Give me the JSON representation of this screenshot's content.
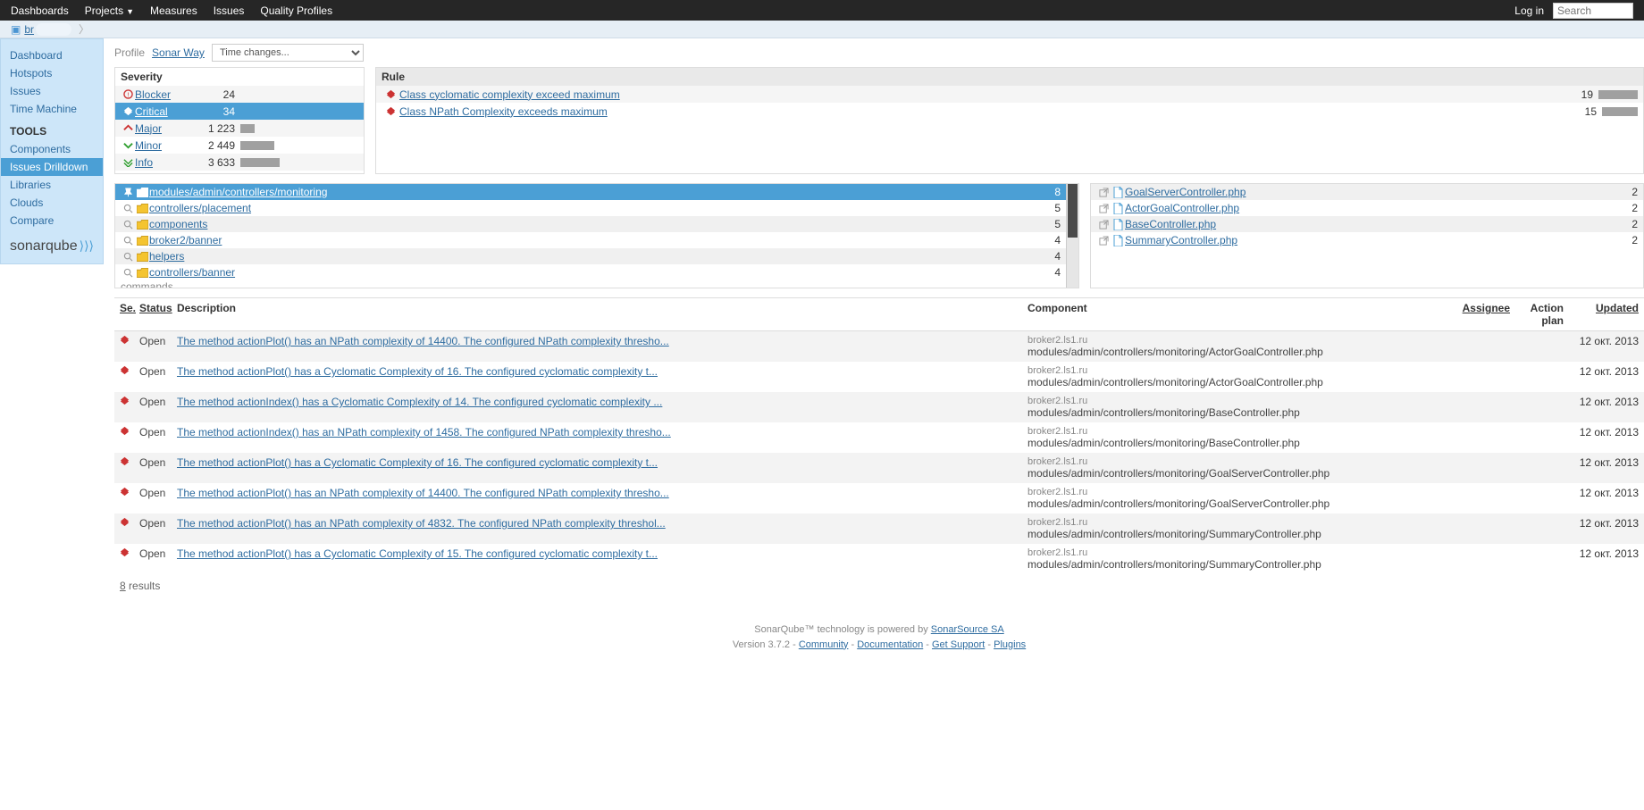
{
  "topnav": {
    "items": [
      "Dashboards",
      "Projects",
      "Measures",
      "Issues",
      "Quality Profiles"
    ],
    "login": "Log in",
    "search_placeholder": "Search"
  },
  "breadcrumb": {
    "project": "br"
  },
  "sidebar": {
    "items": [
      "Dashboard",
      "Hotspots",
      "Issues",
      "Time Machine"
    ],
    "tools_header": "TOOLS",
    "tools": [
      "Components",
      "Issues Drilldown",
      "Libraries",
      "Clouds",
      "Compare"
    ],
    "logo": "sonarqube"
  },
  "profile": {
    "label": "Profile",
    "name": "Sonar Way",
    "time_changes": "Time changes..."
  },
  "severity": {
    "header": "Severity",
    "rows": [
      {
        "name": "Blocker",
        "count": "24",
        "bar": 0
      },
      {
        "name": "Critical",
        "count": "34",
        "bar": 0,
        "selected": true
      },
      {
        "name": "Major",
        "count": "1 223",
        "bar": 16
      },
      {
        "name": "Minor",
        "count": "2 449",
        "bar": 38
      },
      {
        "name": "Info",
        "count": "3 633",
        "bar": 44
      }
    ]
  },
  "rule": {
    "header": "Rule",
    "rows": [
      {
        "name": "Class cyclomatic complexity exceed maximum",
        "count": "19",
        "bar": 44
      },
      {
        "name": "Class NPath Complexity exceeds maximum",
        "count": "15",
        "bar": 40
      }
    ]
  },
  "folders": {
    "rows": [
      {
        "name": "modules/admin/controllers/monitoring",
        "count": "8",
        "selected": true
      },
      {
        "name": "controllers/placement",
        "count": "5"
      },
      {
        "name": "components",
        "count": "5"
      },
      {
        "name": "broker2/banner",
        "count": "4"
      },
      {
        "name": "helpers",
        "count": "4"
      },
      {
        "name": "controllers/banner",
        "count": "4"
      }
    ],
    "truncated": "commands"
  },
  "files": {
    "rows": [
      {
        "name": "GoalServerController.php",
        "count": "2"
      },
      {
        "name": "ActorGoalController.php",
        "count": "2"
      },
      {
        "name": "BaseController.php",
        "count": "2"
      },
      {
        "name": "SummaryController.php",
        "count": "2"
      }
    ]
  },
  "issues": {
    "headers": {
      "se": "Se.",
      "status": "Status",
      "desc": "Description",
      "comp": "Component",
      "assignee": "Assignee",
      "plan": "Action plan",
      "updated": "Updated"
    },
    "rows": [
      {
        "status": "Open",
        "desc": "The method actionPlot() has an NPath complexity of 14400. The configured NPath complexity thresho...",
        "proj": "broker2.ls1.ru",
        "path": "modules/admin/controllers/monitoring/ActorGoalController.php",
        "updated": "12 окт. 2013"
      },
      {
        "status": "Open",
        "desc": "The method actionPlot() has a Cyclomatic Complexity of 16. The configured cyclomatic complexity t...",
        "proj": "broker2.ls1.ru",
        "path": "modules/admin/controllers/monitoring/ActorGoalController.php",
        "updated": "12 окт. 2013"
      },
      {
        "status": "Open",
        "desc": "The method actionIndex() has a Cyclomatic Complexity of 14. The configured cyclomatic complexity ...",
        "proj": "broker2.ls1.ru",
        "path": "modules/admin/controllers/monitoring/BaseController.php",
        "updated": "12 окт. 2013"
      },
      {
        "status": "Open",
        "desc": "The method actionIndex() has an NPath complexity of 1458. The configured NPath complexity thresho...",
        "proj": "broker2.ls1.ru",
        "path": "modules/admin/controllers/monitoring/BaseController.php",
        "updated": "12 окт. 2013"
      },
      {
        "status": "Open",
        "desc": "The method actionPlot() has a Cyclomatic Complexity of 16. The configured cyclomatic complexity t...",
        "proj": "broker2.ls1.ru",
        "path": "modules/admin/controllers/monitoring/GoalServerController.php",
        "updated": "12 окт. 2013"
      },
      {
        "status": "Open",
        "desc": "The method actionPlot() has an NPath complexity of 14400. The configured NPath complexity thresho...",
        "proj": "broker2.ls1.ru",
        "path": "modules/admin/controllers/monitoring/GoalServerController.php",
        "updated": "12 окт. 2013"
      },
      {
        "status": "Open",
        "desc": "The method actionPlot() has an NPath complexity of 4832. The configured NPath complexity threshol...",
        "proj": "broker2.ls1.ru",
        "path": "modules/admin/controllers/monitoring/SummaryController.php",
        "updated": "12 окт. 2013"
      },
      {
        "status": "Open",
        "desc": "The method actionPlot() has a Cyclomatic Complexity of 15. The configured cyclomatic complexity t...",
        "proj": "broker2.ls1.ru",
        "path": "modules/admin/controllers/monitoring/SummaryController.php",
        "updated": "12 окт. 2013"
      }
    ],
    "results_count": "8",
    "results_label": " results"
  },
  "footer": {
    "line1_a": "SonarQube™ technology is powered by ",
    "line1_link": "SonarSource SA",
    "version": "Version 3.7.2 - ",
    "links": [
      "Community",
      "Documentation",
      "Get Support",
      "Plugins"
    ]
  }
}
